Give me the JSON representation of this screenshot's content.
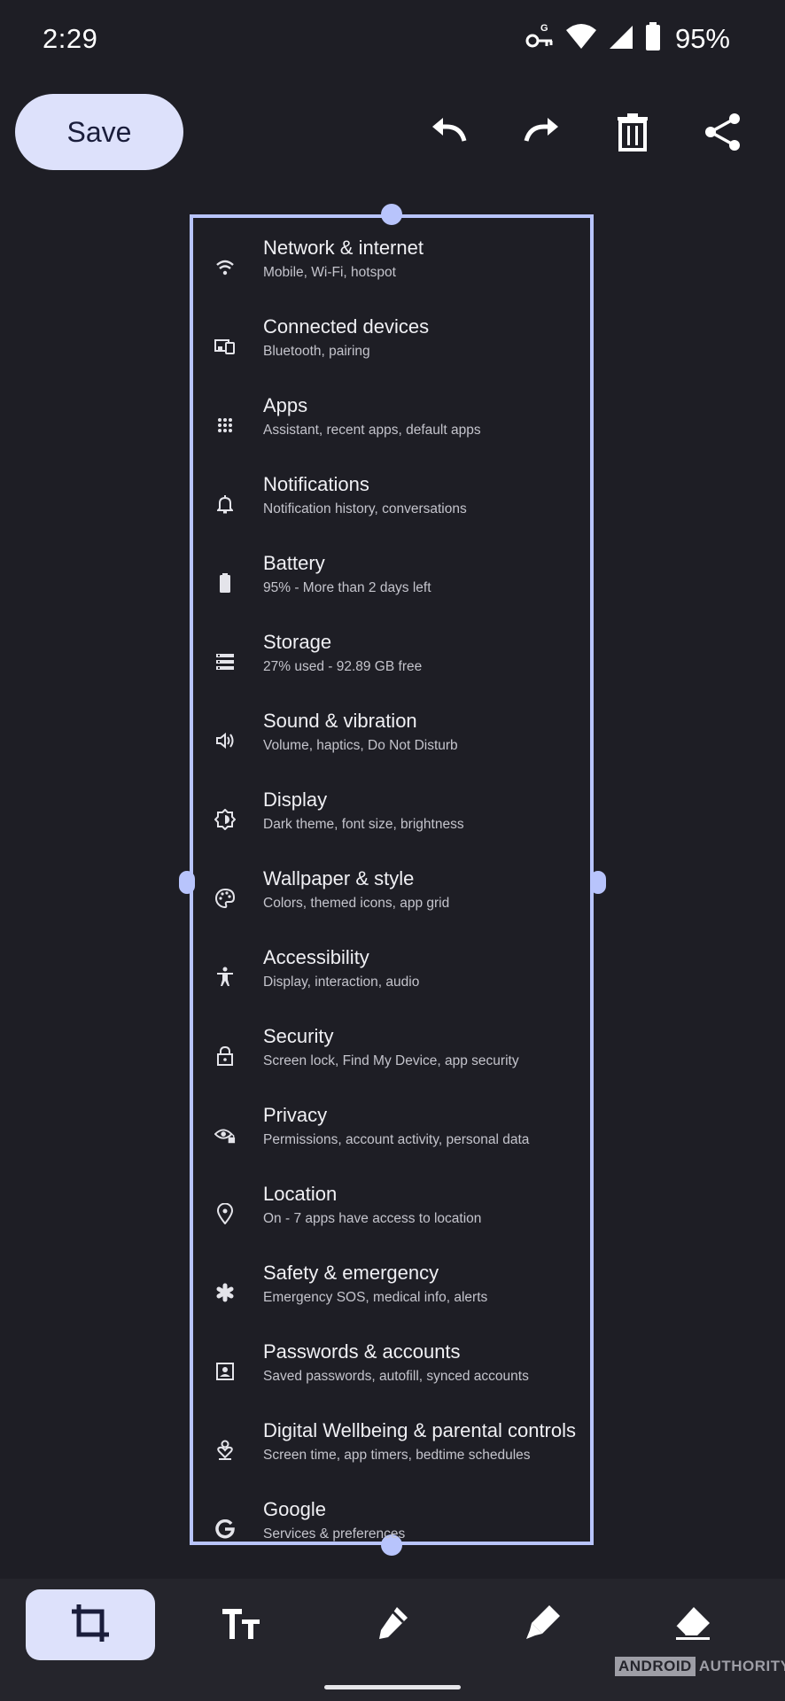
{
  "status_bar": {
    "time": "2:29",
    "battery_percent": "95%",
    "icons": [
      "vpn-key-icon",
      "wifi-icon",
      "signal-icon",
      "battery-icon"
    ]
  },
  "toolbar": {
    "save_label": "Save",
    "actions": [
      "undo-icon",
      "redo-icon",
      "delete-icon",
      "share-icon"
    ]
  },
  "settings": [
    {
      "title": "Network & internet",
      "subtitle": "Mobile, Wi-Fi, hotspot",
      "icon": "wifi-icon"
    },
    {
      "title": "Connected devices",
      "subtitle": "Bluetooth, pairing",
      "icon": "devices-icon"
    },
    {
      "title": "Apps",
      "subtitle": "Assistant, recent apps, default apps",
      "icon": "apps-grid-icon"
    },
    {
      "title": "Notifications",
      "subtitle": "Notification history, conversations",
      "icon": "bell-icon"
    },
    {
      "title": "Battery",
      "subtitle": "95% - More than 2 days left",
      "icon": "battery-icon"
    },
    {
      "title": "Storage",
      "subtitle": "27% used - 92.89 GB free",
      "icon": "storage-icon"
    },
    {
      "title": "Sound & vibration",
      "subtitle": "Volume, haptics, Do Not Disturb",
      "icon": "speaker-icon"
    },
    {
      "title": "Display",
      "subtitle": "Dark theme, font size, brightness",
      "icon": "brightness-icon"
    },
    {
      "title": "Wallpaper & style",
      "subtitle": "Colors, themed icons, app grid",
      "icon": "palette-icon"
    },
    {
      "title": "Accessibility",
      "subtitle": "Display, interaction, audio",
      "icon": "accessibility-icon"
    },
    {
      "title": "Security",
      "subtitle": "Screen lock, Find My Device, app security",
      "icon": "lock-icon"
    },
    {
      "title": "Privacy",
      "subtitle": "Permissions, account activity, personal data",
      "icon": "privacy-eye-icon"
    },
    {
      "title": "Location",
      "subtitle": "On - 7 apps have access to location",
      "icon": "location-pin-icon"
    },
    {
      "title": "Safety & emergency",
      "subtitle": "Emergency SOS, medical info, alerts",
      "icon": "asterisk-icon"
    },
    {
      "title": "Passwords & accounts",
      "subtitle": "Saved passwords, autofill, synced accounts",
      "icon": "account-box-icon"
    },
    {
      "title": "Digital Wellbeing & parental controls",
      "subtitle": "Screen time, app timers, bedtime schedules",
      "icon": "wellbeing-icon"
    },
    {
      "title": "Google",
      "subtitle": "Services & preferences",
      "icon": "google-g-icon"
    }
  ],
  "bottom_tools": [
    "crop-icon",
    "text-icon",
    "pen-icon",
    "highlighter-icon",
    "eraser-icon"
  ],
  "watermark": {
    "part1": "ANDROID",
    "part2": "AUTHORITY"
  },
  "colors": {
    "background": "#1e1e25",
    "accent": "#dde1fb",
    "crop_frame": "#b8c4fc",
    "bottom_bar": "#25252c"
  }
}
